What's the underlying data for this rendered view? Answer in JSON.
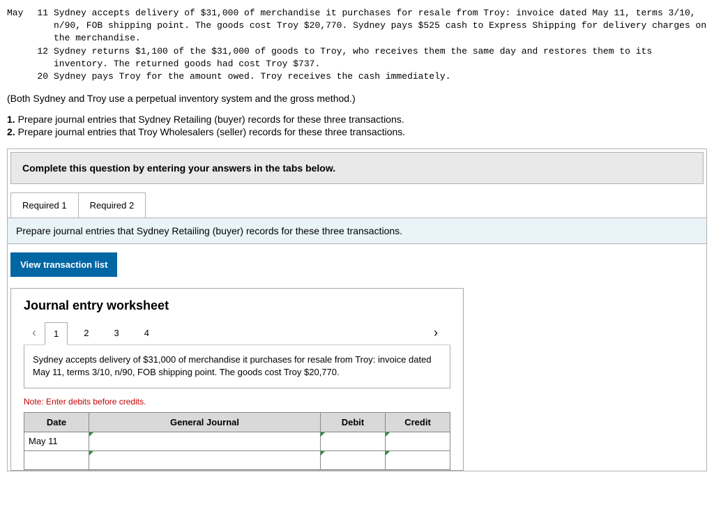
{
  "transactions": {
    "month": "May",
    "rows": [
      {
        "day": "11",
        "text": "Sydney accepts delivery of $31,000 of merchandise it purchases for resale from Troy: invoice dated May 11, terms 3/10, n/90, FOB shipping point. The goods cost Troy $20,770. Sydney pays $525 cash to Express Shipping for delivery charges on the merchandise."
      },
      {
        "day": "12",
        "text": "Sydney returns $1,100 of the $31,000 of goods to Troy, who receives them the same day and restores them to its inventory. The returned goods had cost Troy $737."
      },
      {
        "day": "20",
        "text": "Sydney pays Troy for the amount owed. Troy receives the cash immediately."
      }
    ]
  },
  "paren_note": "(Both Sydney and Troy use a perpetual inventory system and the gross method.)",
  "questions": [
    {
      "num": "1.",
      "text": "Prepare journal entries that Sydney Retailing (buyer) records for these three transactions."
    },
    {
      "num": "2.",
      "text": "Prepare journal entries that Troy Wholesalers (seller) records for these three transactions."
    }
  ],
  "instruction_bar": "Complete this question by entering your answers in the tabs below.",
  "tabs": [
    {
      "label": "Required 1"
    },
    {
      "label": "Required 2"
    }
  ],
  "tab_instruction": "Prepare journal entries that Sydney Retailing (buyer) records for these three transactions.",
  "view_transaction_btn": "View transaction list",
  "worksheet": {
    "title": "Journal entry worksheet",
    "entry_tabs": [
      "1",
      "2",
      "3",
      "4"
    ],
    "entry_desc": "Sydney accepts delivery of $31,000 of merchandise it purchases for resale from Troy: invoice dated May 11, terms 3/10, n/90, FOB shipping point. The goods cost Troy $20,770.",
    "note": "Note: Enter debits before credits.",
    "headers": {
      "date": "Date",
      "gj": "General Journal",
      "debit": "Debit",
      "credit": "Credit"
    },
    "first_date": "May 11"
  }
}
